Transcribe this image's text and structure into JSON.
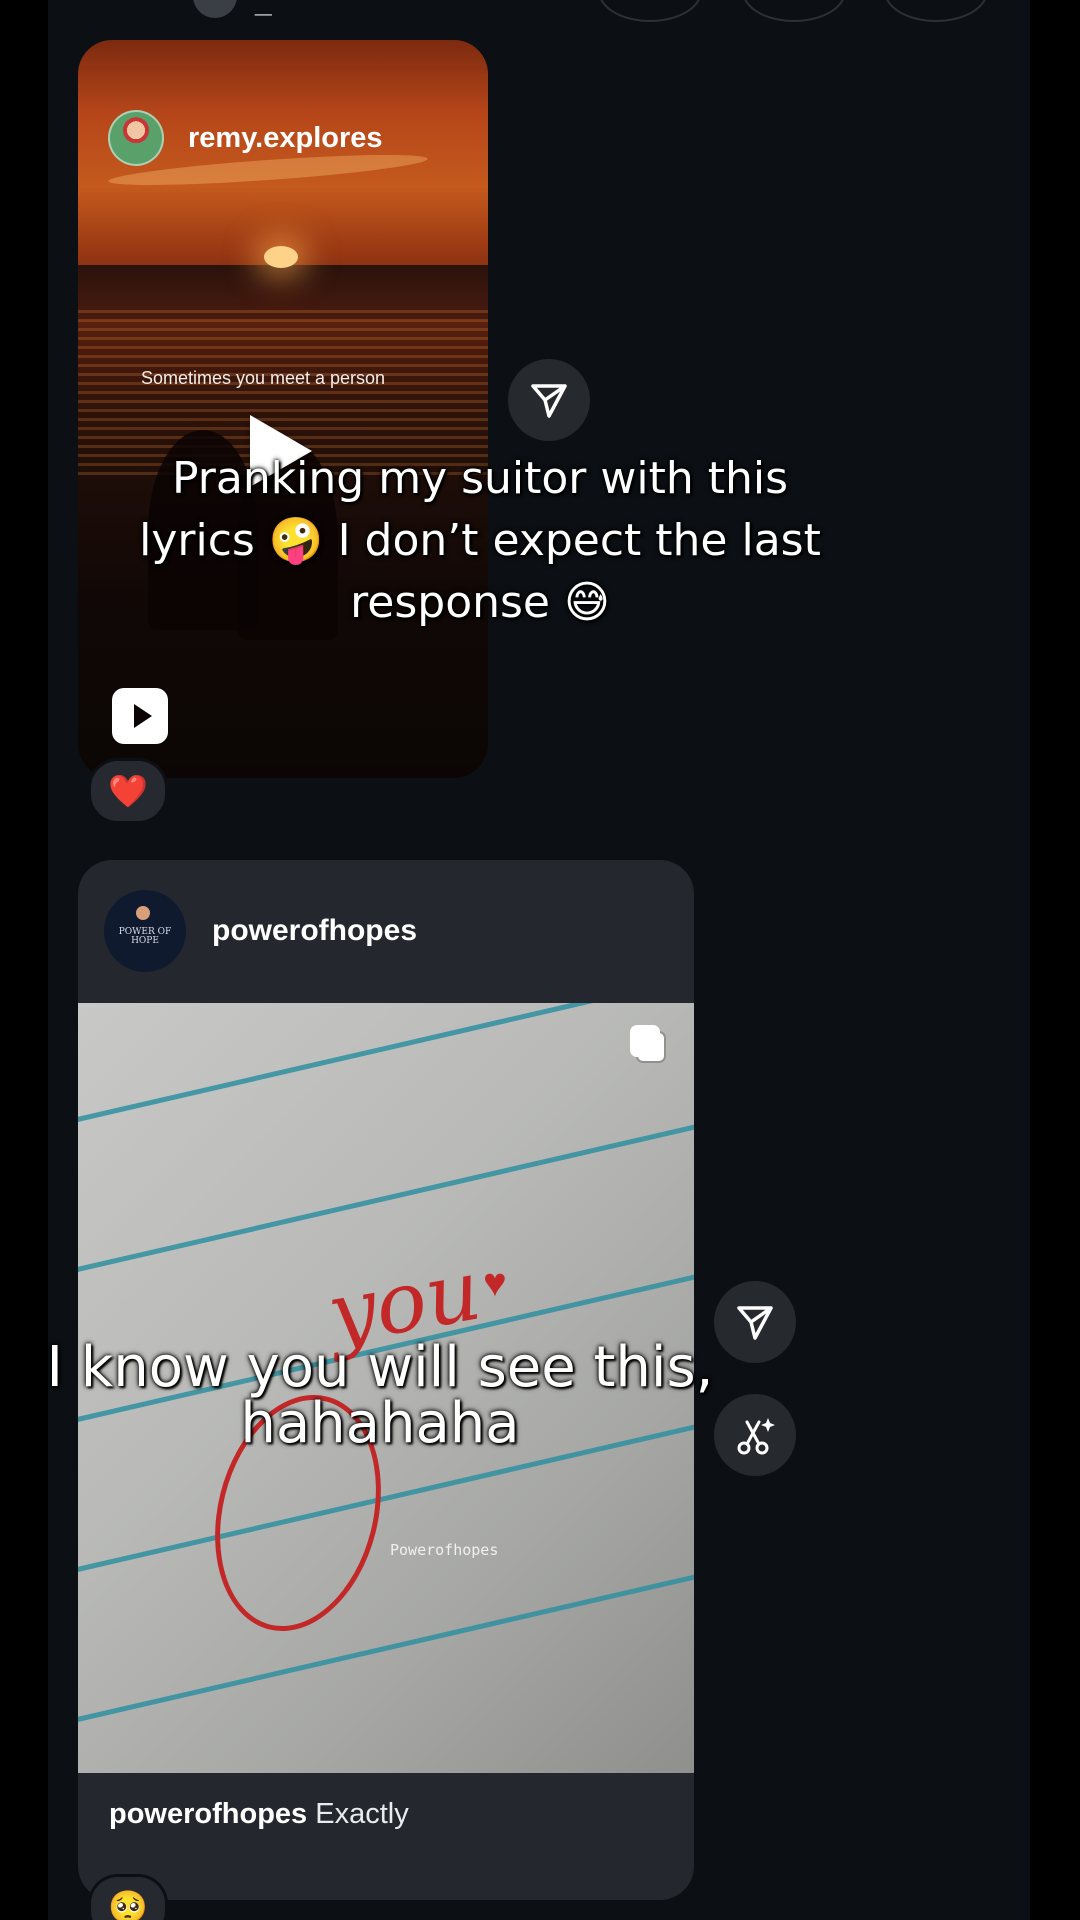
{
  "top_strip": {
    "username_partial": "_"
  },
  "reel": {
    "username": "remy.explores",
    "video_caption": "Sometimes you meet a person",
    "reaction": "❤️"
  },
  "overlay_captions": {
    "first": "Pranking my suitor with this lyrics 🤪 I don’t expect the last response 😅",
    "second": "I know you will see this, hahahaha"
  },
  "post": {
    "username": "powerofhopes",
    "avatar_text": "POWER OF HOPE",
    "image_text": "you",
    "watermark": "Powerofhopes",
    "caption_user": "powerofhopes",
    "caption_text": "Exactly",
    "reaction": "🥺"
  },
  "icons": {
    "share": "paper-plane-icon",
    "remix": "scissors-sparkle-icon",
    "reels": "reels-icon",
    "play": "play-icon",
    "carousel": "multi-photo-icon"
  }
}
